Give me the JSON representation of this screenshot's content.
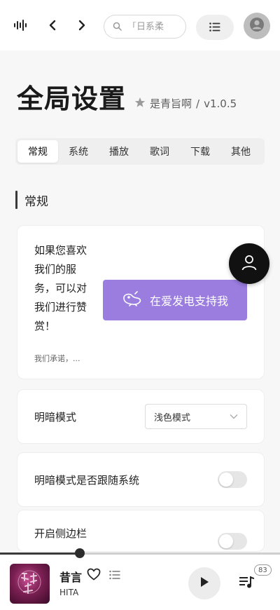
{
  "topbar": {
    "search_placeholder": "「日系柔"
  },
  "page": {
    "title": "全局设置",
    "author": "是青旨啊",
    "separator": "/",
    "version": "v1.0.5"
  },
  "tabs": [
    {
      "label": "常规",
      "active": true
    },
    {
      "label": "系统",
      "active": false
    },
    {
      "label": "播放",
      "active": false
    },
    {
      "label": "歌词",
      "active": false
    },
    {
      "label": "下载",
      "active": false
    },
    {
      "label": "其他",
      "active": false
    }
  ],
  "section": {
    "label": "常规"
  },
  "donate": {
    "text": "如果您喜欢我们的服务，可以对我们进行赞赏！",
    "small_text": "我们承诺，...",
    "button_label": "在爱发电支持我"
  },
  "settings": {
    "theme_mode": {
      "label": "明暗模式",
      "value": "浅色模式"
    },
    "follow_system": {
      "label": "明暗模式是否跟随系统",
      "enabled": false
    },
    "sidebar": {
      "label": "开启侧边栏",
      "enabled": false
    }
  },
  "player": {
    "song_title": "昔言",
    "artist": "HITA",
    "progress": 0.285,
    "queue_count": "83"
  },
  "colors": {
    "accent": "#9b7de0",
    "background": "#f7f7f8"
  }
}
